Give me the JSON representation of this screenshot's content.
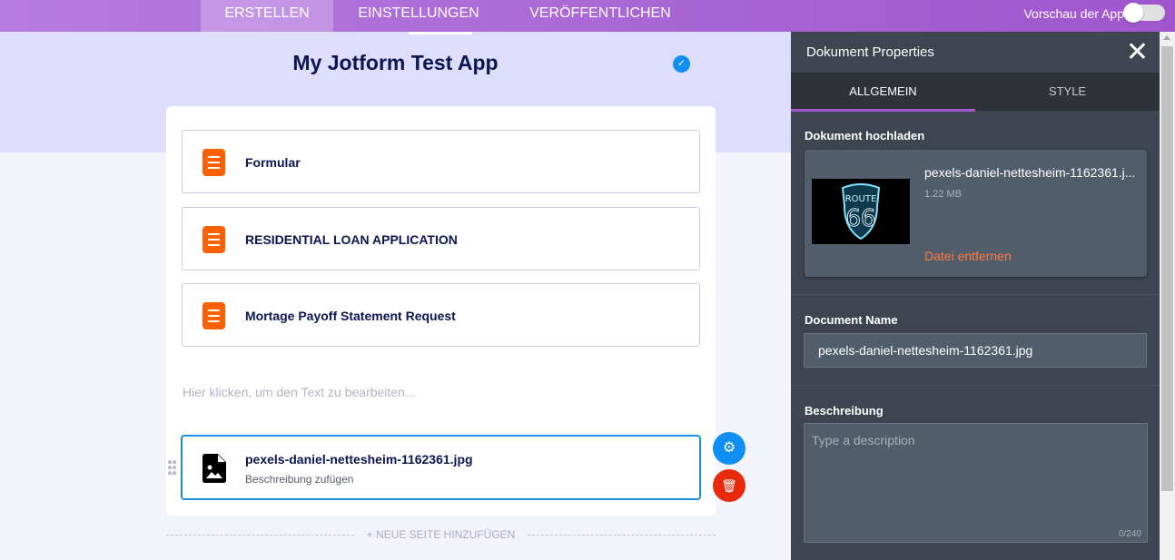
{
  "topbar": {
    "tabs": [
      "ERSTELLEN",
      "EINSTELLUNGEN",
      "VERÖFFENTLICHEN"
    ],
    "active": "ERSTELLEN",
    "preview_label": "Vorschau der App",
    "preview_on": false
  },
  "app": {
    "title": "My Jotform Test App"
  },
  "items": [
    {
      "label": "Formular"
    },
    {
      "label": "RESIDENTIAL LOAN APPLICATION"
    },
    {
      "label": "Mortage Payoff Statement Request"
    }
  ],
  "placeholder_text": "Hier klicken, um den Text zu bearbeiten...",
  "selected": {
    "name": "pexels-daniel-nettesheim-1162361.jpg",
    "desc": "Beschreibung zufügen"
  },
  "add_page": "+ NEUE SEITE HINZUFÜGEN",
  "panel": {
    "title": "Dokument Properties",
    "tabs": [
      "ALLGEMEIN",
      "STYLE"
    ],
    "upload_label": "Dokument hochladen",
    "file_name": "pexels-daniel-nettesheim-1162361.j...",
    "file_size": "1.22 MB",
    "remove": "Datei entfernen",
    "thumb_text": "ROUTE 66",
    "name_label": "Document Name",
    "name_value": "pexels-daniel-nettesheim-1162361.jpg",
    "desc_label": "Beschreibung",
    "desc_placeholder": "Type a description",
    "desc_count": "0/240"
  },
  "colors": {
    "accent": "#a259d0",
    "file_icon": "#ff6100",
    "blue": "#0f8ef5",
    "red": "#e8290b",
    "remove": "#ff7a3d"
  }
}
